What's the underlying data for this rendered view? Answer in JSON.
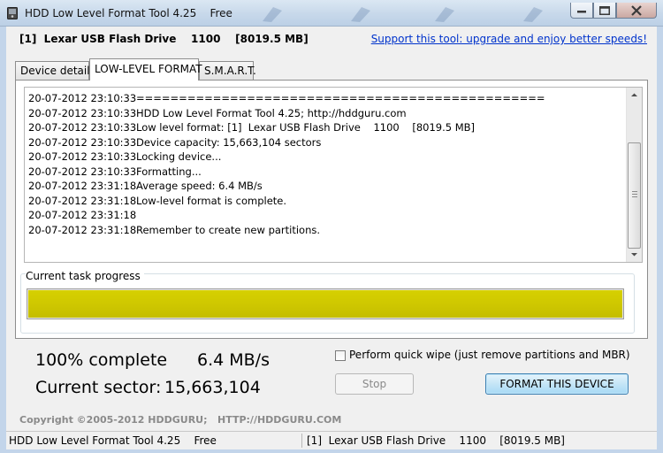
{
  "window": {
    "title": "HDD Low Level Format Tool 4.25    Free"
  },
  "header": {
    "device": "[1]  Lexar USB Flash Drive    1100    [8019.5 MB]",
    "support_link": "Support this tool: upgrade and enjoy better speeds!"
  },
  "tabs": [
    {
      "label": "Device details"
    },
    {
      "label": "LOW-LEVEL FORMAT"
    },
    {
      "label": "S.M.A.R.T."
    }
  ],
  "log": [
    {
      "time": "20-07-2012 23:10:33",
      "msg": "================================================"
    },
    {
      "time": "20-07-2012 23:10:33",
      "msg": "HDD Low Level Format Tool 4.25; http://hddguru.com"
    },
    {
      "time": "20-07-2012 23:10:33",
      "msg": "Low level format: [1]  Lexar USB Flash Drive    1100    [8019.5 MB]"
    },
    {
      "time": "20-07-2012 23:10:33",
      "msg": "Device capacity: 15,663,104 sectors"
    },
    {
      "time": "20-07-2012 23:10:33",
      "msg": "Locking device..."
    },
    {
      "time": "20-07-2012 23:10:33",
      "msg": "Formatting..."
    },
    {
      "time": "20-07-2012 23:31:18",
      "msg": "Average speed: 6.4 MB/s"
    },
    {
      "time": "20-07-2012 23:31:18",
      "msg": "Low-level format is complete."
    },
    {
      "time": "20-07-2012 23:31:18",
      "msg": ""
    },
    {
      "time": "20-07-2012 23:31:18",
      "msg": "Remember to create new partitions."
    }
  ],
  "progress": {
    "label": "Current task progress",
    "fraction": 1.0,
    "color": "#d4cc00"
  },
  "stats": {
    "complete": "100% complete",
    "speed": "6.4 MB/s",
    "sector_label": "Current sector:",
    "sector_value": "15,663,104"
  },
  "options": {
    "quick_wipe_label": "Perform quick wipe (just remove partitions and MBR)",
    "quick_wipe_checked": false
  },
  "buttons": {
    "stop": "Stop",
    "format": "FORMAT THIS DEVICE"
  },
  "footer": {
    "copyright": "Copyright ©2005-2012 HDDGURU;   HTTP://HDDGURU.COM"
  },
  "statusbar": {
    "left": "HDD Low Level Format Tool 4.25    Free",
    "right": "[1]  Lexar USB Flash Drive    1100    [8019.5 MB]"
  },
  "icons": {
    "app": "hdd-app-icon",
    "minimize": "minimize-icon",
    "maximize": "maximize-icon",
    "close": "close-icon",
    "scroll_up": "arrow-up-icon",
    "scroll_down": "arrow-down-icon"
  },
  "colors": {
    "link": "#0033cc",
    "progress": "#d4cc00",
    "format_button": "#c4e5f6"
  }
}
